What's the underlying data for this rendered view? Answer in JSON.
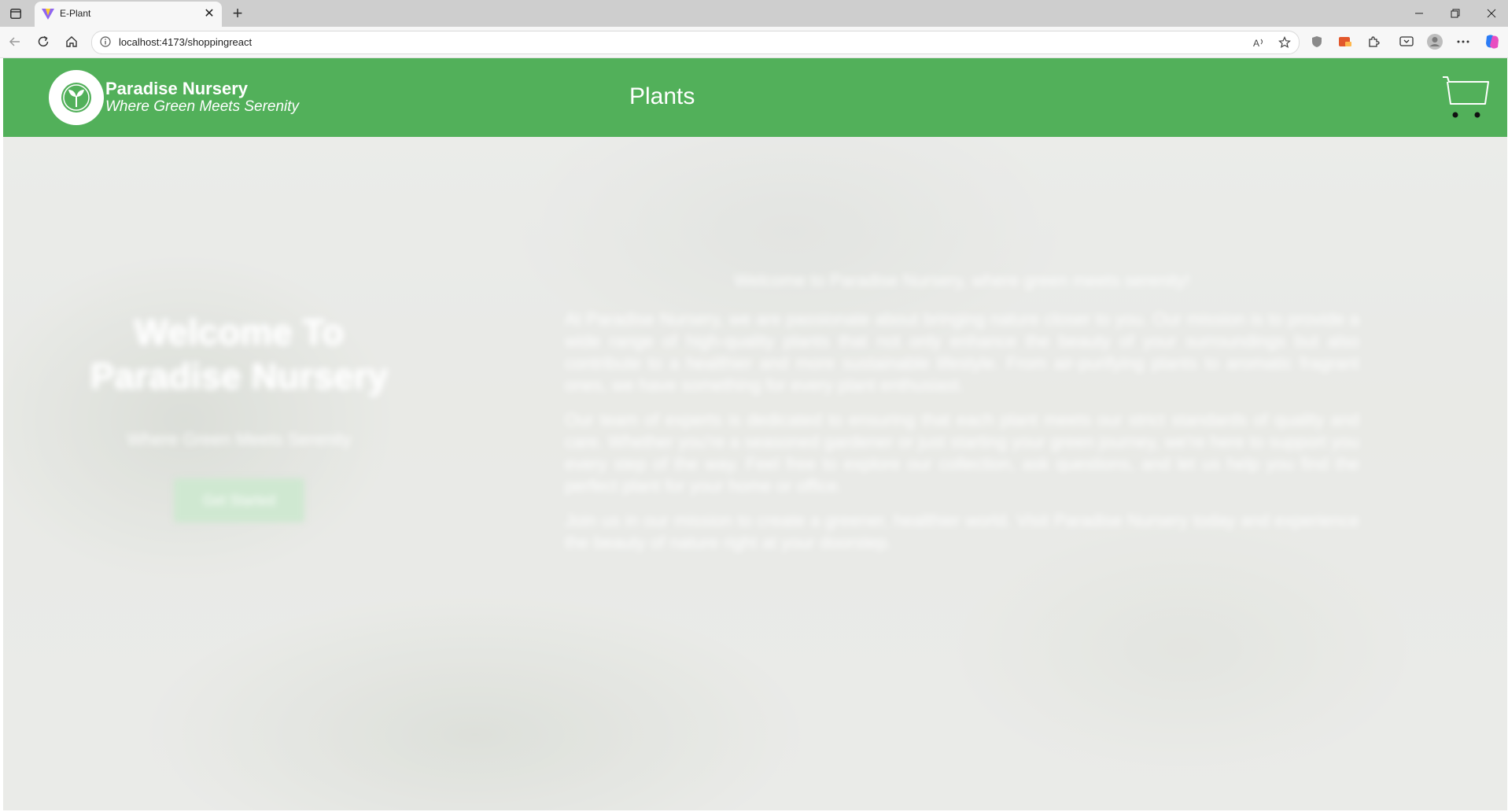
{
  "browser": {
    "tab_title": "E-Plant",
    "tab_close": "✕",
    "new_tab": "+",
    "url": "localhost:4173/shoppingreact"
  },
  "navbar": {
    "brand_name": "Paradise Nursery",
    "brand_tagline": "Where Green Meets Serenity",
    "title": "Plants",
    "background_color": "#52b05a"
  },
  "landing": {
    "hero_title_line1": "Welcome To",
    "hero_title_line2": "Paradise Nursery",
    "hero_subtitle": "Where Green Meets Serenity",
    "get_started_label": "Get Started",
    "about_title": "Welcome to Paradise Nursery, where green meets serenity!",
    "about_p1": "At Paradise Nursery, we are passionate about bringing nature closer to you. Our mission is to provide a wide range of high-quality plants that not only enhance the beauty of your surroundings but also contribute to a healthier and more sustainable lifestyle. From air-purifying plants to aromatic fragrant ones, we have something for every plant enthusiast.",
    "about_p2": "Our team of experts is dedicated to ensuring that each plant meets our strict standards of quality and care. Whether you're a seasoned gardener or just starting your green journey, we're here to support you every step of the way. Feel free to explore our collection, ask questions, and let us help you find the perfect plant for your home or office.",
    "about_p3": "Join us in our mission to create a greener, healthier world. Visit Paradise Nursery today and experience the beauty of nature right at your doorstep."
  },
  "icons": {
    "tab_actions": "tab-actions-icon",
    "favicon": "vite-logo-icon",
    "back": "back-arrow-icon",
    "reload": "reload-icon",
    "home": "home-icon",
    "info": "info-icon",
    "read_aloud": "read-aloud-icon",
    "favorite": "star-icon",
    "cart": "shopping-cart-icon",
    "logo": "sprout-icon"
  }
}
